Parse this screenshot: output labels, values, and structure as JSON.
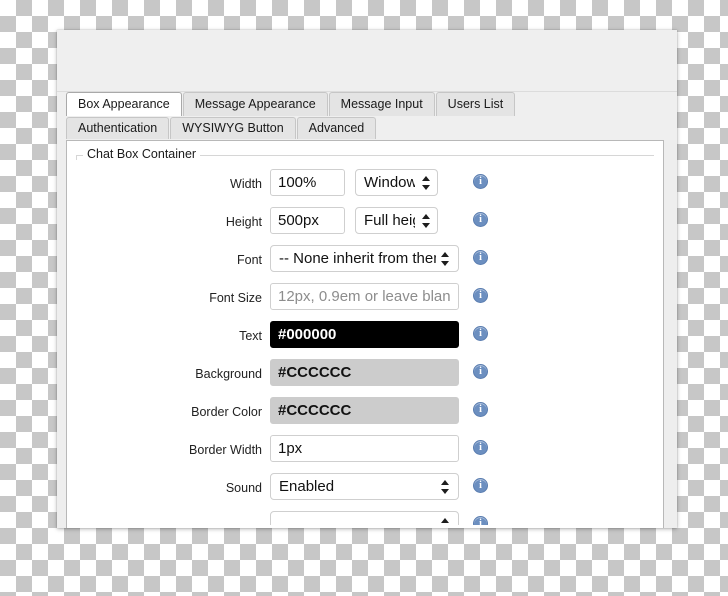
{
  "window": {
    "title": ""
  },
  "tabs_row1": [
    {
      "label": "Box Appearance",
      "active": true
    },
    {
      "label": "Message Appearance",
      "active": false
    },
    {
      "label": "Message Input",
      "active": false
    },
    {
      "label": "Users List",
      "active": false
    }
  ],
  "tabs_row2": [
    {
      "label": "Authentication",
      "active": false
    },
    {
      "label": "WYSIWYG Button",
      "active": false
    },
    {
      "label": "Advanced",
      "active": false
    }
  ],
  "group": {
    "legend": "Chat Box Container"
  },
  "fields": [
    {
      "label": "Width",
      "value": "100%",
      "placeholder": "",
      "select": "Window",
      "info": "i"
    },
    {
      "label": "Height",
      "value": "500px",
      "placeholder": "",
      "select": "Full height",
      "info": "i"
    },
    {
      "label": "Font",
      "select": "-- None inherit from theme",
      "info": "i"
    },
    {
      "label": "Font Size",
      "value": "",
      "placeholder": "12px, 0.9em or leave blank",
      "info": "i"
    },
    {
      "label": "Text",
      "value": "#000000",
      "swatch": "#000000",
      "info": "i"
    },
    {
      "label": "Background",
      "value": "#CCCCCC",
      "swatch": "#CCCCCC",
      "info": "i"
    },
    {
      "label": "Border Color",
      "value": "#CCCCCC",
      "swatch": "#CCCCCC",
      "info": "i"
    },
    {
      "label": "Border Width",
      "value": "1px",
      "placeholder": "",
      "info": "i"
    },
    {
      "label": "Sound",
      "select": "Enabled",
      "info": "i"
    }
  ],
  "colors": {
    "accent_info": "#6c8fc0",
    "text_swatch": "#000000",
    "background_swatch": "#CCCCCC",
    "border_swatch": "#CCCCCC"
  }
}
